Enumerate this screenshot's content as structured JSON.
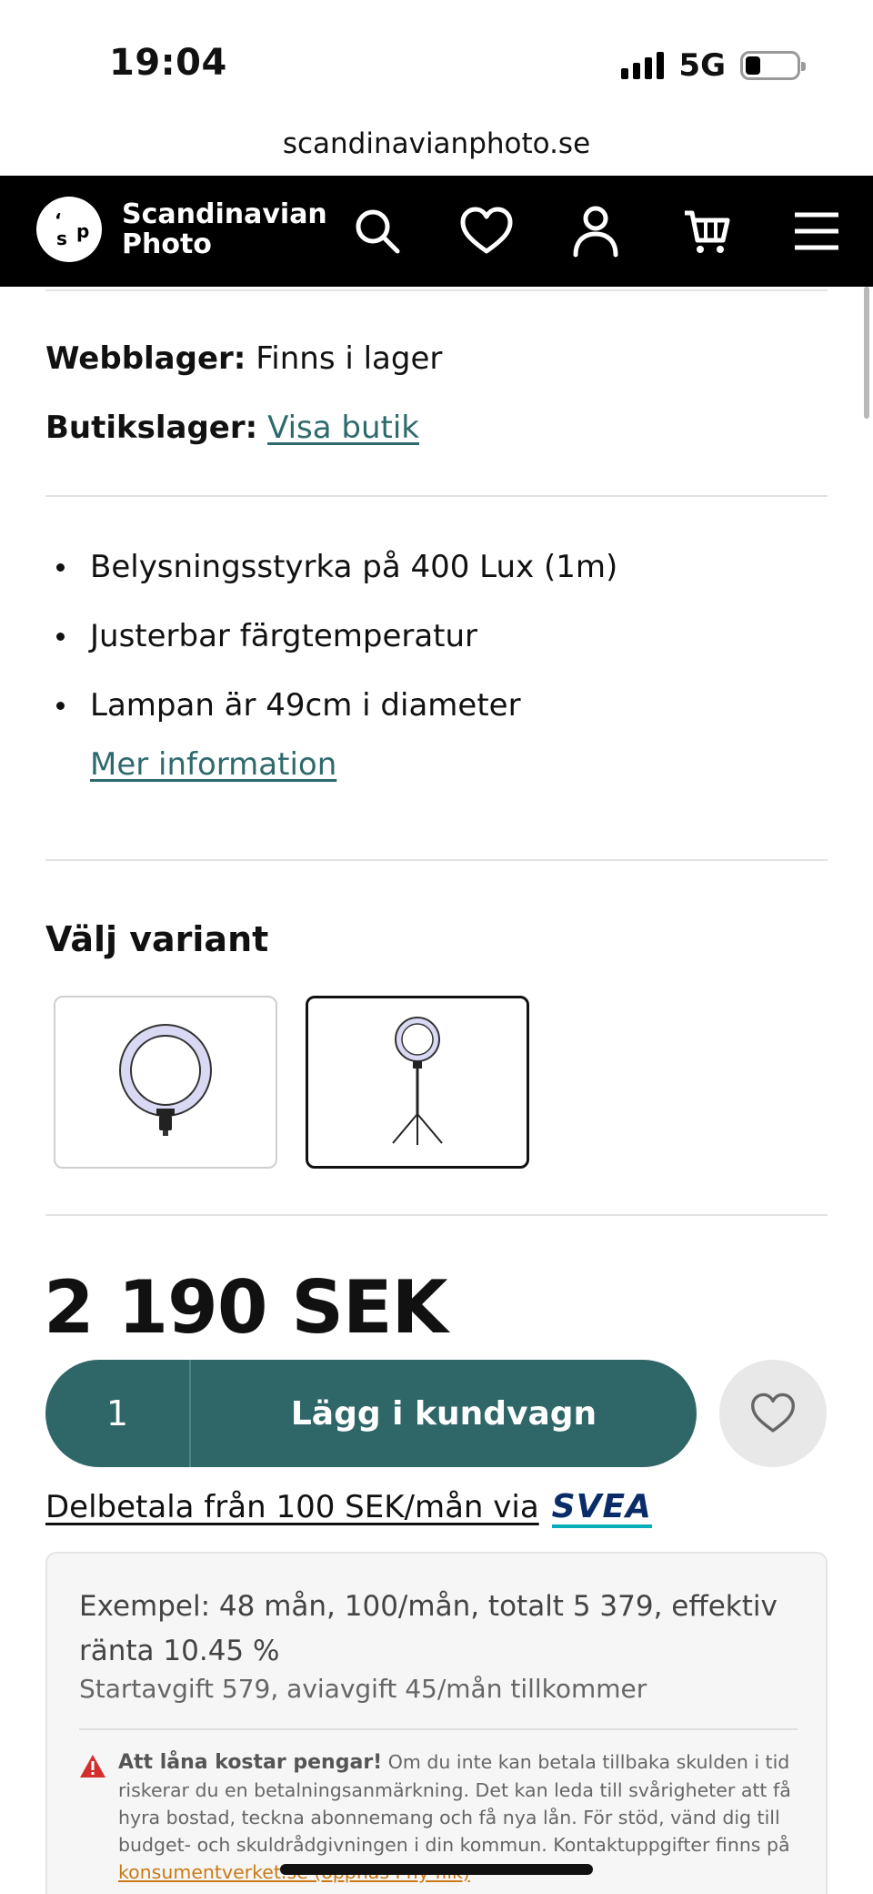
{
  "status_bar": {
    "time": "19:04",
    "network": "5G"
  },
  "browser": {
    "url": "scandinavianphoto.se"
  },
  "header": {
    "logo_line1": "Scandinavian",
    "logo_line2": "Photo",
    "logo_letter_1": "s",
    "logo_letter_2": "p",
    "icons": [
      "search-icon",
      "heart-icon",
      "user-icon",
      "cart-icon",
      "menu-icon"
    ]
  },
  "stock": {
    "web_label": "Webblager:",
    "web_value": "Finns i lager",
    "store_label": "Butikslager:",
    "store_link": "Visa butik"
  },
  "features": [
    "Belysningsstyrka på 400 Lux (1m)",
    "Justerbar färgtemperatur",
    "Lampan är 49cm i diameter"
  ],
  "more_info": "Mer information",
  "variant": {
    "title": "Välj variant",
    "selected_index": 1
  },
  "price": "2 190 SEK",
  "cart": {
    "quantity": "1",
    "add_label": "Lägg i kundvagn"
  },
  "financing": {
    "text": "Delbetala från 100 SEK/mån via",
    "provider": "SVEA",
    "example": "Exempel: 48 mån, 100/mån, totalt 5 379, effektiv ränta 10.45 %",
    "fees": "Startavgift 579, aviavgift 45/mån tillkommer",
    "warning_title": "Att låna kostar pengar!",
    "warning_body": "Om du inte kan betala tillbaka skulden i tid riskerar du en betalningsanmärkning. Det kan leda till svårigheter att få hyra bostad, teckna abonnemang och få nya lån. För stöd, vänd dig till budget- och skuldrådgivningen i din kommun. Kontaktuppgifter finns på",
    "warning_link": "konsumentverket.se (öppnas i ny flik)"
  },
  "colors": {
    "accent_teal": "#2f6668",
    "link_teal": "#2e6a6c",
    "header_bg": "#000000",
    "svea_blue": "#0a2d6a",
    "warning_red": "#d32f2f"
  }
}
